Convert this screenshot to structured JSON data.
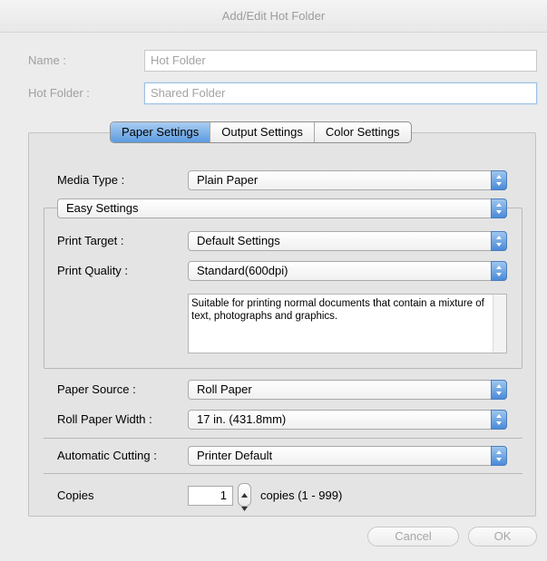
{
  "window": {
    "title": "Add/Edit Hot Folder"
  },
  "name_field": {
    "label": "Name :",
    "value": "Hot Folder"
  },
  "hot_folder_field": {
    "label": "Hot Folder :",
    "value": "Shared Folder"
  },
  "tabs": [
    {
      "label": "Paper Settings",
      "active": true
    },
    {
      "label": "Output Settings",
      "active": false
    },
    {
      "label": "Color Settings",
      "active": false
    }
  ],
  "media_type": {
    "label": "Media Type :",
    "value": "Plain Paper"
  },
  "easy_settings": {
    "value": "Easy Settings"
  },
  "print_target": {
    "label": "Print Target :",
    "value": "Default Settings"
  },
  "print_quality": {
    "label": "Print Quality :",
    "value": "Standard(600dpi)"
  },
  "description": {
    "text": "Suitable for printing normal documents that contain a mixture of text, photographs and graphics."
  },
  "paper_source": {
    "label": "Paper Source :",
    "value": "Roll Paper"
  },
  "roll_paper_width": {
    "label": "Roll Paper Width :",
    "value": "17 in. (431.8mm)"
  },
  "automatic_cutting": {
    "label": "Automatic Cutting :",
    "value": "Printer Default"
  },
  "copies": {
    "label": "Copies",
    "value": "1",
    "range_text": "copies (1 - 999)"
  },
  "buttons": {
    "cancel": "Cancel",
    "ok": "OK"
  },
  "colors": {
    "accent": "#5c9be0",
    "disabled_text": "#a6a6a6",
    "background": "#ececec"
  },
  "icons": {
    "popup_arrows": "up-down-arrows-icon",
    "stepper": "stepper-arrows-icon"
  }
}
